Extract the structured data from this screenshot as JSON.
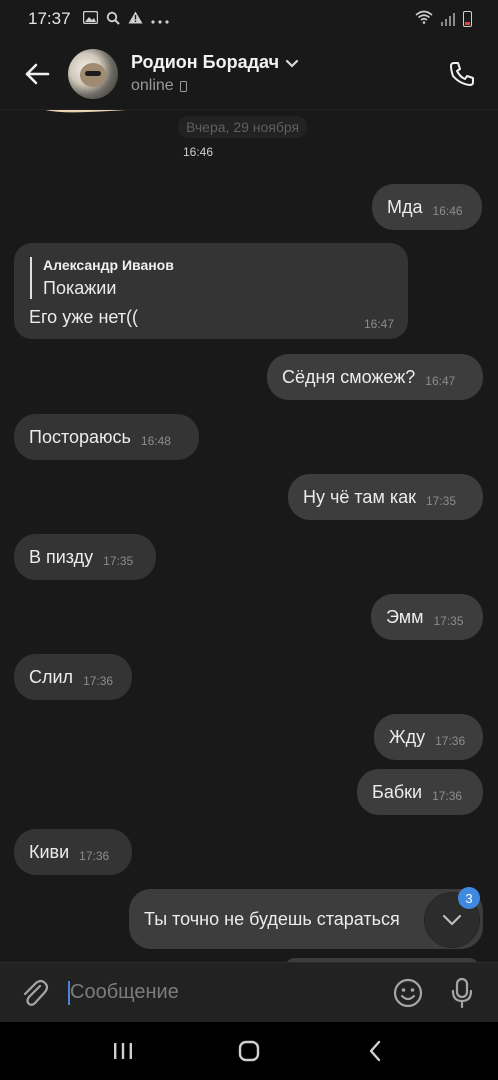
{
  "status_bar": {
    "time": "17:37"
  },
  "header": {
    "name": "Родион Борадач",
    "status": "online"
  },
  "chat": {
    "date_separator": "Вчера, 29 ноября",
    "sticker_time": "16:46",
    "reply": {
      "quote_author": "Александр Иванов",
      "quote_text": "Покажии",
      "text": "Его уже нет((",
      "time": "16:47"
    },
    "messages": [
      {
        "text": "Мда",
        "time": "16:46",
        "dir": "out"
      },
      {
        "text": "Сёдня сможеж?",
        "time": "16:47",
        "dir": "out"
      },
      {
        "text": "Постораюсь",
        "time": "16:48",
        "dir": "in"
      },
      {
        "text": "Ну чё там как",
        "time": "17:35",
        "dir": "out"
      },
      {
        "text": "В пизду",
        "time": "17:35",
        "dir": "in"
      },
      {
        "text": "Эмм",
        "time": "17:35",
        "dir": "out"
      },
      {
        "text": "Слил",
        "time": "17:36",
        "dir": "in"
      },
      {
        "text": "Жду",
        "time": "17:36",
        "dir": "out"
      },
      {
        "text": "Бабки",
        "time": "17:36",
        "dir": "out"
      },
      {
        "text": "Киви",
        "time": "17:36",
        "dir": "in"
      },
      {
        "text": "Ты точно не будешь стараться",
        "time": "",
        "dir": "out"
      }
    ],
    "unread_count": "3"
  },
  "composer": {
    "placeholder": "Сообщение"
  },
  "icons": [
    "back-arrow-icon",
    "phone-icon",
    "attach-icon",
    "emoji-icon",
    "microphone-icon",
    "chevron-down-icon",
    "recent-apps-icon",
    "home-icon",
    "back-nav-icon"
  ]
}
